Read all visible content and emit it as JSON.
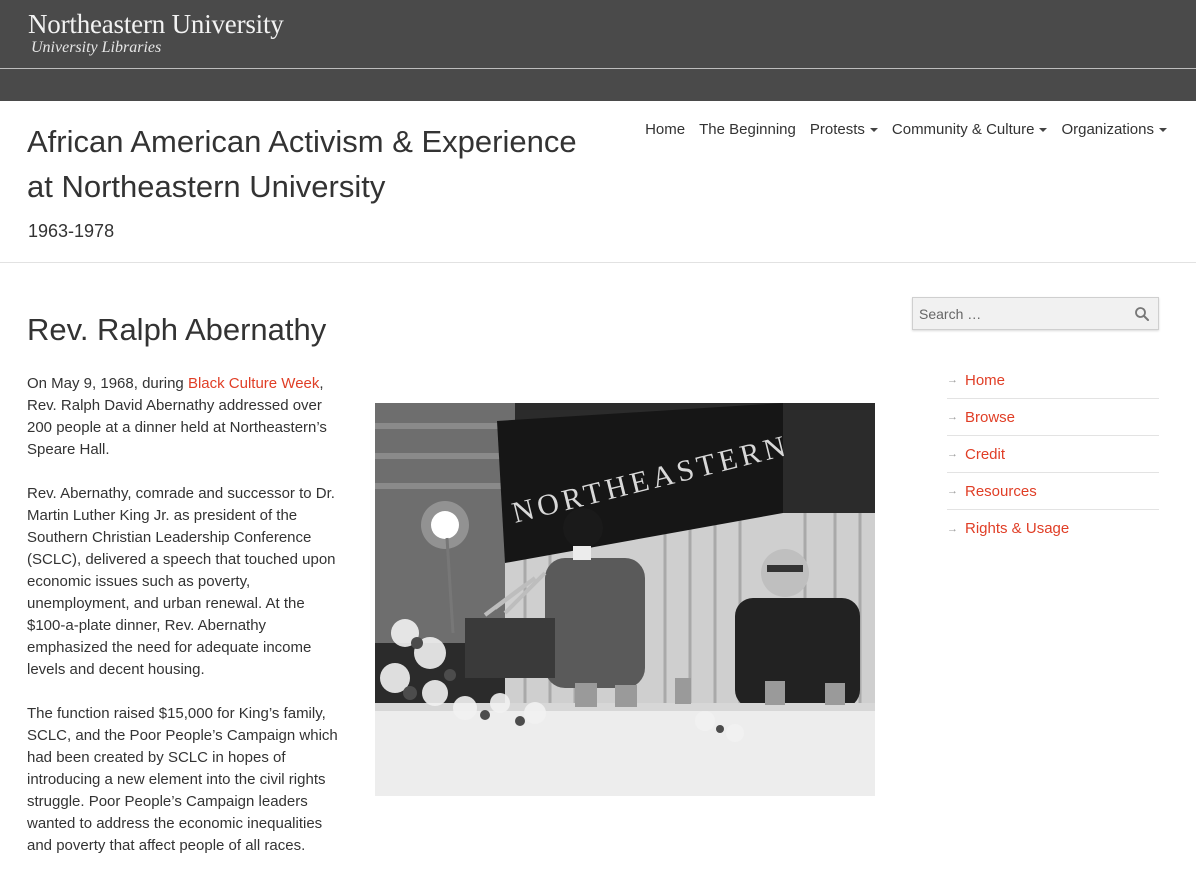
{
  "brand": {
    "name": "Northeastern University",
    "sub": "University Libraries"
  },
  "site": {
    "title_line1": "African American Activism & Experience",
    "title_line2": "at Northeastern University",
    "dates": "1963-1978"
  },
  "nav": {
    "items": [
      {
        "label": "Home"
      },
      {
        "label": "The Beginning"
      },
      {
        "label": "Protests"
      },
      {
        "label": "Community & Culture"
      },
      {
        "label": "Organizations"
      }
    ]
  },
  "article": {
    "title": "Rev. Ralph Abernathy",
    "p1_prefix": "On May 9, 1968, during ",
    "p1_link": "Black Culture Week",
    "p1_rest": ", Rev. Ralph David Abernathy addressed over 200 people at a dinner held at Northeastern’s Speare Hall.",
    "p2": "Rev. Abernathy, comrade and successor to Dr. Martin Luther King Jr. as president of the Southern Christian Leadership Conference (SCLC), delivered a speech that touched upon economic issues such as poverty, unemployment, and urban renewal. At the $100-a-plate dinner, Rev. Abernathy emphasized the need for adequate income levels and decent housing.",
    "p3": "The function raised $15,000 for King’s family, SCLC, and the Poor People’s Campaign which had been created by SCLC in hopes of introducing a new element into the civil rights struggle. Poor People’s Campaign leaders wanted to address the economic inequalities and poverty that affect people of all races.",
    "banner_text": "NORTHEASTERN"
  },
  "search": {
    "placeholder": "Search …"
  },
  "sidebar": {
    "items": [
      {
        "label": "Home"
      },
      {
        "label": "Browse"
      },
      {
        "label": "Credit"
      },
      {
        "label": "Resources"
      },
      {
        "label": "Rights & Usage"
      }
    ]
  },
  "colors": {
    "accent": "#e03e26",
    "header_bg": "#4a4a4a"
  }
}
